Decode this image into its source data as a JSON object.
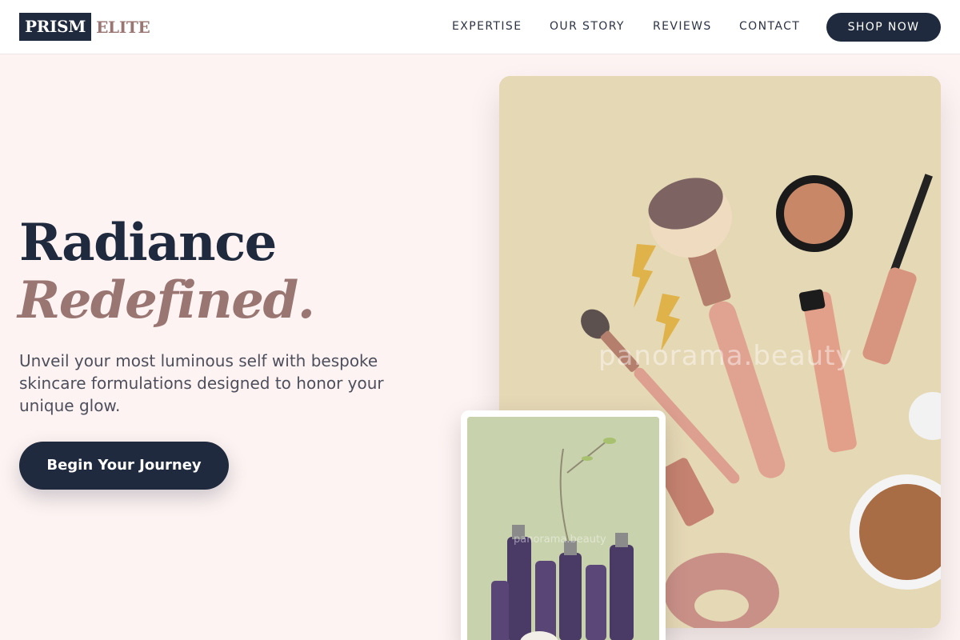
{
  "brand": {
    "name_box": "PRISM",
    "name_rest": "ELITE"
  },
  "nav": {
    "items": [
      "EXPERTISE",
      "OUR STORY",
      "REVIEWS",
      "CONTACT"
    ],
    "shop_label": "SHOP NOW"
  },
  "hero": {
    "title_line1": "Radiance",
    "title_line2": "Redefined.",
    "subtitle": "Unveil your most luminous self with bespoke skincare formulations designed to honor your unique glow.",
    "cta_label": "Begin Your Journey"
  },
  "images": {
    "main_watermark": "panorama.beauty",
    "card_watermark": "panorama.beauty"
  },
  "colors": {
    "navy": "#1f2a3e",
    "mauve": "#9a7673",
    "page_bg": "#fdf3f2"
  }
}
